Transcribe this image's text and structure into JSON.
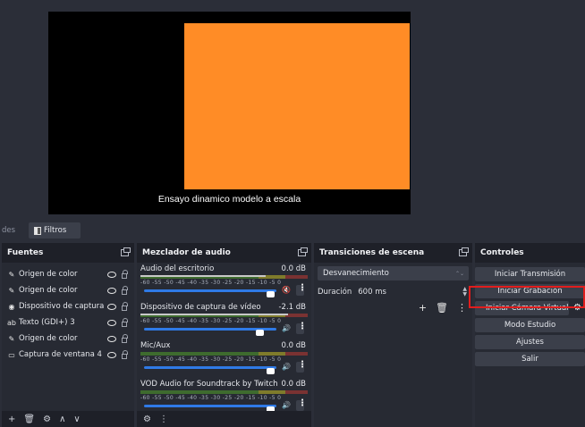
{
  "preview": {
    "caption": "Ensayo dinamico modelo a escala",
    "source_color": "#ff8c26"
  },
  "tabs": {
    "fragment": "des",
    "filters": "Filtros"
  },
  "sources": {
    "title": "Fuentes",
    "items": [
      {
        "label": "Origen de color",
        "icon": "brush-icon"
      },
      {
        "label": "Origen de color",
        "icon": "brush-icon"
      },
      {
        "label": "Dispositivo de captura",
        "icon": "camera-icon"
      },
      {
        "label": "Texto (GDI+) 3",
        "icon": "text-icon"
      },
      {
        "label": "Origen de color",
        "icon": "brush-icon"
      },
      {
        "label": "Captura de ventana 4",
        "icon": "window-icon"
      }
    ],
    "footer": [
      "+",
      "🗑",
      "⚙",
      "∧",
      "∨"
    ]
  },
  "mixer": {
    "title": "Mezclador de audio",
    "tick_labels": "-60 -55 -50 -45 -40 -35 -30 -25 -20 -15 -10 -5 0",
    "channels": [
      {
        "name": "Audio del escritorio",
        "db": "0.0 dB",
        "muted": true,
        "level": 0.75
      },
      {
        "name": "Dispositivo de captura de vídeo",
        "db": "-2.1 dB",
        "muted": false,
        "level": 0.88
      },
      {
        "name": "Mic/Aux",
        "db": "0.0 dB",
        "muted": false,
        "level": 0.0
      },
      {
        "name": "VOD Audio for Soundtrack by Twitch",
        "db": "0.0 dB",
        "muted": false,
        "level": 0.0
      }
    ]
  },
  "transitions": {
    "title": "Transiciones de escena",
    "selected": "Desvanecimiento",
    "duration_label": "Duración",
    "duration_value": "600 ms"
  },
  "controls": {
    "title": "Controles",
    "start_stream": "Iniciar Transmisión",
    "start_record": "Iniciar Grabación",
    "virtual_cam": "Iniciar Cámara Virtual",
    "studio_mode": "Modo Estudio",
    "settings": "Ajustes",
    "exit": "Salir",
    "highlight_color": "#e11d1d"
  }
}
